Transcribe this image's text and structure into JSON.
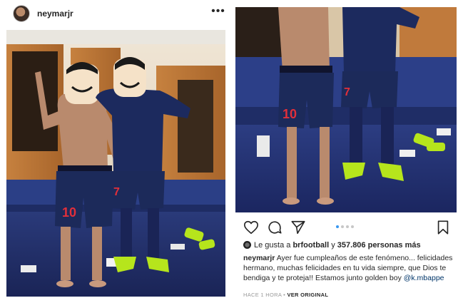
{
  "post": {
    "username": "neymarjr",
    "more_label": "•••"
  },
  "photos": {
    "left_alt": "Two players in the locker room wearing masks",
    "right_alt": "Locker room floor with boots"
  },
  "carousel": {
    "count": 4,
    "active_index": 0
  },
  "likes": {
    "prefix": "Le gusta a",
    "user": "brfootball",
    "connector": "y",
    "count_text": "357.806 personas más"
  },
  "caption": {
    "author": "neymarjr",
    "text": "Ayer fue cumpleaños de este fenómeno... felicidades hermano, muchas felicidades en tu vida siempre, que Dios te bendiga y te proteja!! Estamos junto golden boy",
    "mention": "@k.mbappe"
  },
  "meta": {
    "time": "HACE 1 HORA",
    "separator": "•",
    "translate": "VER ORIGINAL"
  },
  "colors": {
    "accent": "#3897f0",
    "text": "#262626",
    "muted": "#999999",
    "mention": "#003569"
  },
  "icons": {
    "like": "heart-outline-icon",
    "comment": "speech-bubble-icon",
    "share": "paper-plane-icon",
    "save": "bookmark-outline-icon"
  }
}
